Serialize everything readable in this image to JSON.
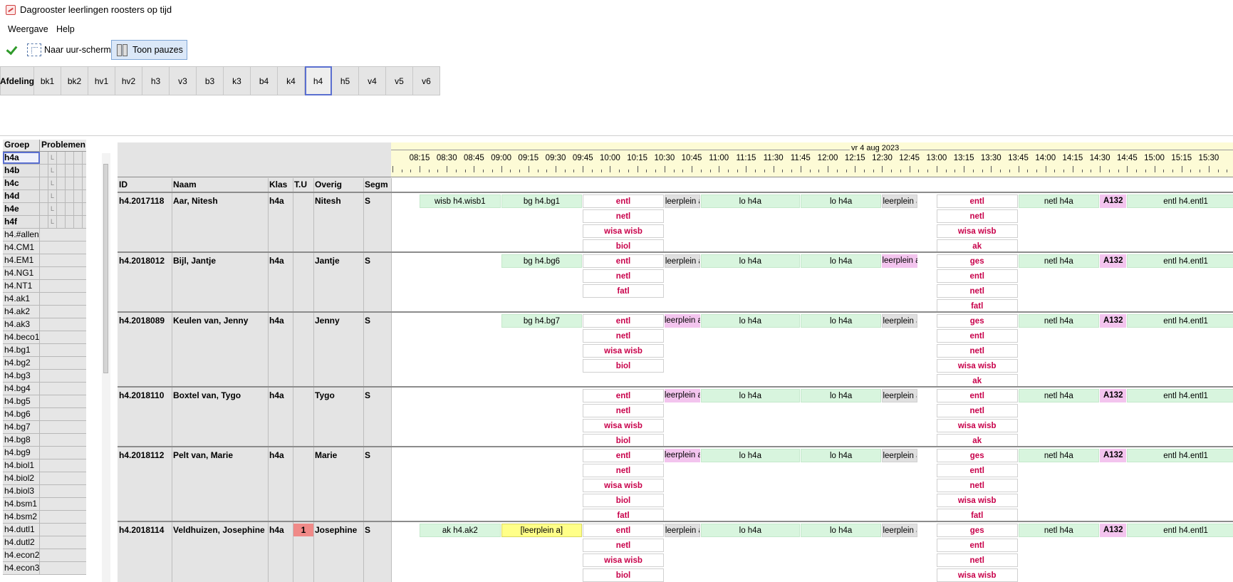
{
  "window": {
    "title": "Dagrooster leerlingen roosters op tijd"
  },
  "menu": {
    "weergave": "Weergave",
    "help": "Help"
  },
  "toolbar": {
    "uur_scherm": "Naar uur-scherm",
    "pauzes": "Toon pauzes"
  },
  "departments": {
    "label": "Afdeling",
    "tabs": [
      "bk1",
      "bk2",
      "hv1",
      "hv2",
      "h3",
      "v3",
      "b3",
      "k3",
      "b4",
      "k4",
      "h4",
      "h5",
      "v4",
      "v5",
      "v6"
    ],
    "selected": "h4"
  },
  "groups": {
    "header": {
      "groep": "Groep",
      "problemen": "Problemen"
    },
    "main": [
      "h4a",
      "h4b",
      "h4c",
      "h4d",
      "h4e",
      "h4f"
    ],
    "selected": "h4a",
    "sub": [
      "h4.#allen",
      "h4.CM1",
      "h4.EM1",
      "h4.NG1",
      "h4.NT1",
      "h4.ak1",
      "h4.ak2",
      "h4.ak3",
      "h4.beco1",
      "h4.bg1",
      "h4.bg2",
      "h4.bg3",
      "h4.bg4",
      "h4.bg5",
      "h4.bg6",
      "h4.bg7",
      "h4.bg8",
      "h4.bg9",
      "h4.biol1",
      "h4.biol2",
      "h4.biol3",
      "h4.bsm1",
      "h4.bsm2",
      "h4.dutl1",
      "h4.dutl2",
      "h4.econ2",
      "h4.econ3"
    ]
  },
  "timeline": {
    "date": "vr 4 aug 2023",
    "times": [
      "08:15",
      "08:30",
      "08:45",
      "09:00",
      "09:15",
      "09:30",
      "09:45",
      "10:00",
      "10:15",
      "10:30",
      "10:45",
      "11:00",
      "11:15",
      "11:30",
      "11:45",
      "12:00",
      "12:15",
      "12:30",
      "12:45",
      "13:00",
      "13:15",
      "13:30",
      "13:45",
      "14:00",
      "14:15",
      "14:30",
      "14:45",
      "15:00",
      "15:15",
      "15:30"
    ]
  },
  "columns": {
    "id": "ID",
    "naam": "Naam",
    "klas": "Klas",
    "tu": "T.U",
    "overig": "Overig",
    "segm": "Segm"
  },
  "students": [
    {
      "id": "h4.2017118",
      "naam": "Aar, Nitesh",
      "klas": "h4a",
      "tu": "",
      "overig": "Nitesh",
      "segm": "S",
      "slot1": "wisb h4.wisb1",
      "slot2": "bg h4.bg1",
      "slot2_style": "green",
      "block1": [
        "entl",
        "netl",
        "wisa wisb",
        "biol"
      ],
      "b_leer1": "leerplein a",
      "b_leer1_style": "gray",
      "b_lo1": "lo h4a",
      "b_lo2": "lo h4a",
      "b_leer2": "leerplein a",
      "b_leer2_style": "gray",
      "block2": [
        "entl",
        "netl",
        "wisa wisb",
        "ak"
      ],
      "b_netl": "netl h4a",
      "room": "A132",
      "b_entl": "entl h4.entl1"
    },
    {
      "id": "h4.2018012",
      "naam": "Bijl, Jantje",
      "klas": "h4a",
      "tu": "",
      "overig": "Jantje",
      "segm": "S",
      "slot1": "",
      "slot2": "bg h4.bg6",
      "slot2_style": "green",
      "block1": [
        "entl",
        "netl",
        "fatl"
      ],
      "b_leer1": "leerplein a",
      "b_leer1_style": "gray",
      "b_lo1": "lo h4a",
      "b_lo2": "lo h4a",
      "b_leer2": "leerplein a",
      "b_leer2_style": "pink",
      "block2": [
        "ges",
        "entl",
        "netl",
        "fatl"
      ],
      "b_netl": "netl h4a",
      "room": "A132",
      "b_entl": "entl h4.entl1"
    },
    {
      "id": "h4.2018089",
      "naam": "Keulen van, Jenny",
      "klas": "h4a",
      "tu": "",
      "overig": "Jenny",
      "segm": "S",
      "slot1": "",
      "slot2": "bg h4.bg7",
      "slot2_style": "green",
      "block1": [
        "entl",
        "netl",
        "wisa wisb",
        "biol"
      ],
      "b_leer1": "leerplein a",
      "b_leer1_style": "pink",
      "b_lo1": "lo h4a",
      "b_lo2": "lo h4a",
      "b_leer2": "leerplein a",
      "b_leer2_style": "gray",
      "block2": [
        "ges",
        "entl",
        "netl",
        "wisa wisb",
        "ak"
      ],
      "b_netl": "netl h4a",
      "room": "A132",
      "b_entl": "entl h4.entl1"
    },
    {
      "id": "h4.2018110",
      "naam": "Boxtel van, Tygo",
      "klas": "h4a",
      "tu": "",
      "overig": "Tygo",
      "segm": "S",
      "slot1": "",
      "slot2": "",
      "slot2_style": "green",
      "block1": [
        "entl",
        "netl",
        "wisa wisb",
        "biol"
      ],
      "b_leer1": "leerplein a",
      "b_leer1_style": "pink",
      "b_lo1": "lo h4a",
      "b_lo2": "lo h4a",
      "b_leer2": "leerplein a",
      "b_leer2_style": "gray",
      "block2": [
        "entl",
        "netl",
        "wisa wisb",
        "ak"
      ],
      "b_netl": "netl h4a",
      "room": "A132",
      "b_entl": "entl h4.entl1"
    },
    {
      "id": "h4.2018112",
      "naam": "Pelt van, Marie",
      "klas": "h4a",
      "tu": "",
      "overig": "Marie",
      "segm": "S",
      "slot1": "",
      "slot2": "",
      "slot2_style": "green",
      "block1": [
        "entl",
        "netl",
        "wisa wisb",
        "biol",
        "fatl"
      ],
      "b_leer1": "leerplein a",
      "b_leer1_style": "pink",
      "b_lo1": "lo h4a",
      "b_lo2": "lo h4a",
      "b_leer2": "leerplein a",
      "b_leer2_style": "gray",
      "block2": [
        "ges",
        "entl",
        "netl",
        "wisa wisb",
        "fatl"
      ],
      "b_netl": "netl h4a",
      "room": "A132",
      "b_entl": "entl h4.entl1"
    },
    {
      "id": "h4.2018114",
      "naam": "Veldhuizen, Josephine",
      "klas": "h4a",
      "tu": "1",
      "overig": "Josephine",
      "segm": "S",
      "slot1": "ak h4.ak2",
      "slot2": "[leerplein a]",
      "slot2_style": "yellow",
      "block1": [
        "entl",
        "netl",
        "wisa wisb",
        "biol"
      ],
      "b_leer1": "leerplein a",
      "b_leer1_style": "gray",
      "b_lo1": "lo h4a",
      "b_lo2": "lo h4a",
      "b_leer2": "leerplein a",
      "b_leer2_style": "gray",
      "block2": [
        "ges",
        "entl",
        "netl",
        "wisa wisb"
      ],
      "b_netl": "netl h4a",
      "room": "A132",
      "b_entl": "entl h4.entl1"
    }
  ]
}
